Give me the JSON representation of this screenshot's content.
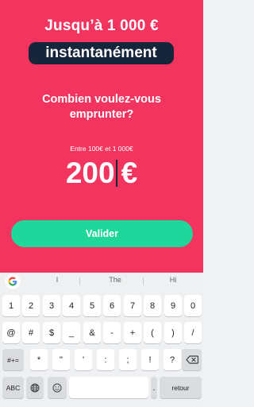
{
  "header": {
    "line1": "Jusqu’à 1 000 €",
    "line2": "instantanément"
  },
  "form": {
    "question_line1": "Combien voulez-vous",
    "question_line2": "emprunter?",
    "range_hint": "Entre 100€ et 1 000€",
    "amount_value": "200",
    "currency": "€",
    "submit_label": "Valider"
  },
  "keyboard": {
    "suggestions": [
      "I",
      "The",
      "Hi"
    ],
    "row1": [
      "1",
      "2",
      "3",
      "4",
      "5",
      "6",
      "7",
      "8",
      "9",
      "0"
    ],
    "row2": [
      "@",
      "#",
      "$",
      "_",
      "&",
      "-",
      "+",
      "(",
      ")",
      "/"
    ],
    "row3": [
      "=\\<",
      "*",
      "\"",
      "'",
      ":",
      ";",
      "!",
      "?"
    ],
    "row3_left": "#+=",
    "abc_label": "ABC",
    "comma_label": ",",
    "period_label": ".",
    "enter_label": "retour"
  },
  "icons": {
    "logo": "google-g-icon",
    "globe": "globe-icon",
    "emoji": "emoji-icon",
    "backspace": "backspace-icon"
  },
  "colors": {
    "background": "#f2345f",
    "pill": "#17253b",
    "button": "#1fd79a",
    "keyboard": "#eef0f1"
  }
}
